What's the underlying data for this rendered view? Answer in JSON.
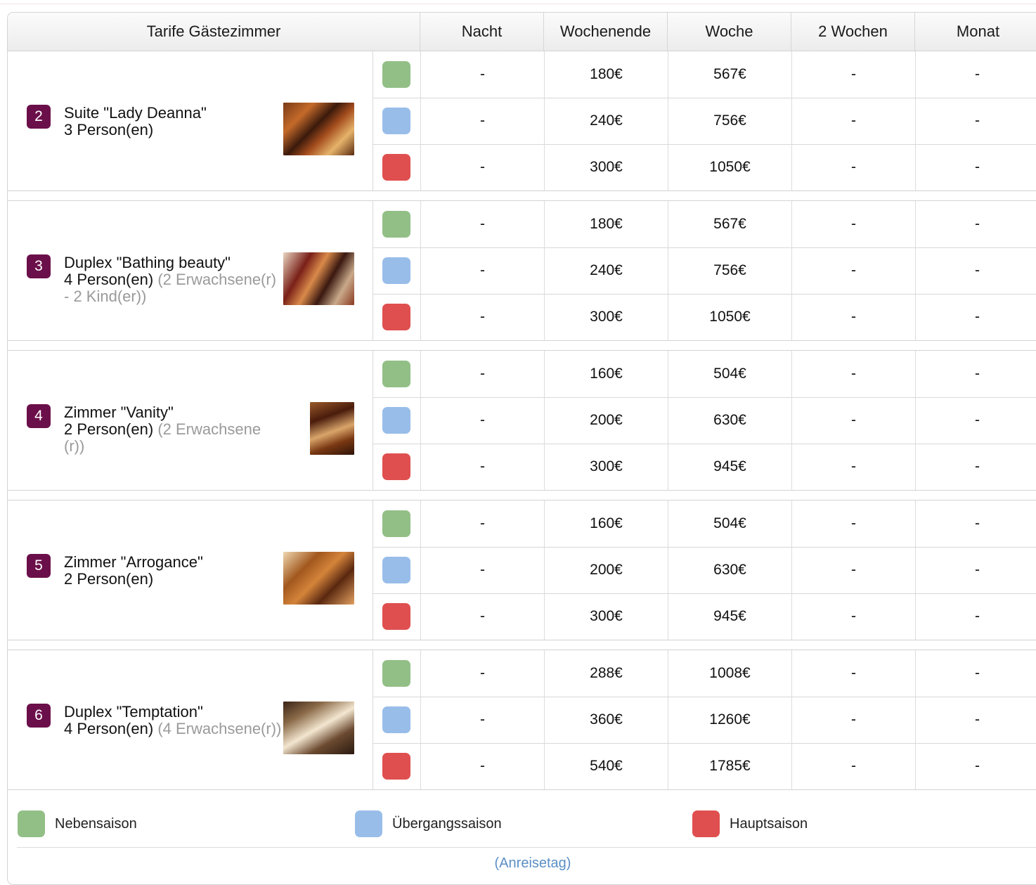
{
  "header": {
    "room_col": "Tarife Gästezimmer",
    "cols": [
      "Nacht",
      "Wochenende",
      "Woche",
      "2 Wochen",
      "Monat"
    ]
  },
  "seasons": {
    "low": {
      "label": "Nebensaison",
      "color": "#92bf86"
    },
    "mid": {
      "label": "Übergangssaison",
      "color": "#98bde9"
    },
    "high": {
      "label": "Hauptsaison",
      "color": "#e04f4f"
    }
  },
  "rooms": [
    {
      "num": "2",
      "name": "Suite \"Lady Deanna\"",
      "persons": "3 Person(en)",
      "detail": "",
      "rates": [
        [
          "-",
          "180€",
          "567€",
          "-",
          "-"
        ],
        [
          "-",
          "240€",
          "756€",
          "-",
          "-"
        ],
        [
          "-",
          "300€",
          "1050€",
          "-",
          "-"
        ]
      ]
    },
    {
      "num": "3",
      "name": "Duplex \"Bathing beauty\"",
      "persons": "4 Person(en)",
      "detail": "(2 Erwachsene(r) - 2 Kind(er))",
      "rates": [
        [
          "-",
          "180€",
          "567€",
          "-",
          "-"
        ],
        [
          "-",
          "240€",
          "756€",
          "-",
          "-"
        ],
        [
          "-",
          "300€",
          "1050€",
          "-",
          "-"
        ]
      ]
    },
    {
      "num": "4",
      "name": "Zimmer \"Vanity\"",
      "persons": "2 Person(en)",
      "detail": "(2 Erwachsene (r))",
      "rates": [
        [
          "-",
          "160€",
          "504€",
          "-",
          "-"
        ],
        [
          "-",
          "200€",
          "630€",
          "-",
          "-"
        ],
        [
          "-",
          "300€",
          "945€",
          "-",
          "-"
        ]
      ]
    },
    {
      "num": "5",
      "name": "Zimmer \"Arrogance\"",
      "persons": "2 Person(en)",
      "detail": "",
      "rates": [
        [
          "-",
          "160€",
          "504€",
          "-",
          "-"
        ],
        [
          "-",
          "200€",
          "630€",
          "-",
          "-"
        ],
        [
          "-",
          "300€",
          "945€",
          "-",
          "-"
        ]
      ]
    },
    {
      "num": "6",
      "name": "Duplex \"Temptation\"",
      "persons": "4 Person(en)",
      "detail": "(4 Erwachsene(r))",
      "rates": [
        [
          "-",
          "288€",
          "1008€",
          "-",
          "-"
        ],
        [
          "-",
          "360€",
          "1260€",
          "-",
          "-"
        ],
        [
          "-",
          "540€",
          "1785€",
          "-",
          "-"
        ]
      ]
    }
  ],
  "footer": {
    "link": "(Anreisetag)"
  }
}
